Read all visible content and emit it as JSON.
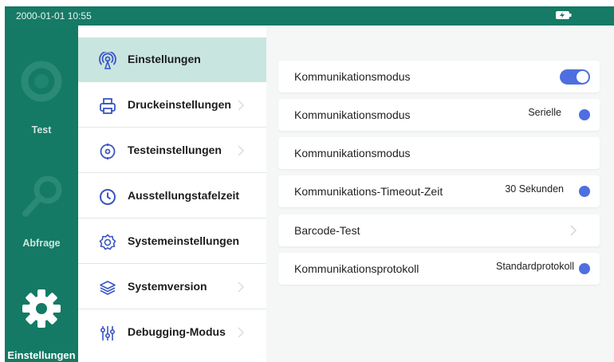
{
  "status_bar": {
    "time": "2000-01-01 10:55",
    "icon": "battery-charging-icon"
  },
  "rail": {
    "items": [
      {
        "label": "Test",
        "icon": "test-icon",
        "active": false
      },
      {
        "label": "Abfrage",
        "icon": "query-search-icon",
        "active": false
      },
      {
        "label": "Einstellungen",
        "icon": "gear-icon",
        "active": true
      }
    ]
  },
  "menu": {
    "items": [
      {
        "label": "Einstellungen",
        "icon": "antenna-icon",
        "active": true
      },
      {
        "label": "Druckeinstellungen",
        "icon": "printer-icon"
      },
      {
        "label": "Testeinstellungen",
        "icon": "target-icon"
      },
      {
        "label": "Ausstellungstafelzeit",
        "icon": "clock-icon"
      },
      {
        "label": "Systemeinstellungen",
        "icon": "settings-gear-icon"
      },
      {
        "label": "Systemversion",
        "icon": "layers-icon"
      },
      {
        "label": "Debugging-Modus",
        "icon": "sliders-icon"
      }
    ]
  },
  "settings": {
    "rows": [
      {
        "label": "Kommunikationsmodus",
        "control": "toggle",
        "on": true
      },
      {
        "label": "Kommunikationsmodus",
        "value": "Serielle"
      },
      {
        "label": "Kommunikationsmodus"
      },
      {
        "label": "Kommunikations-Timeout-Zeit",
        "value": "30 Sekunden"
      },
      {
        "label": "Barcode-Test"
      },
      {
        "label": "Kommunikationsprotokoll",
        "value": "Standardprotokoll"
      }
    ]
  },
  "colors": {
    "brand": "#147a65",
    "menu_active": "#c9e5e0",
    "accent": "#4f6ee0",
    "menu_icon": "#3b55c4"
  }
}
